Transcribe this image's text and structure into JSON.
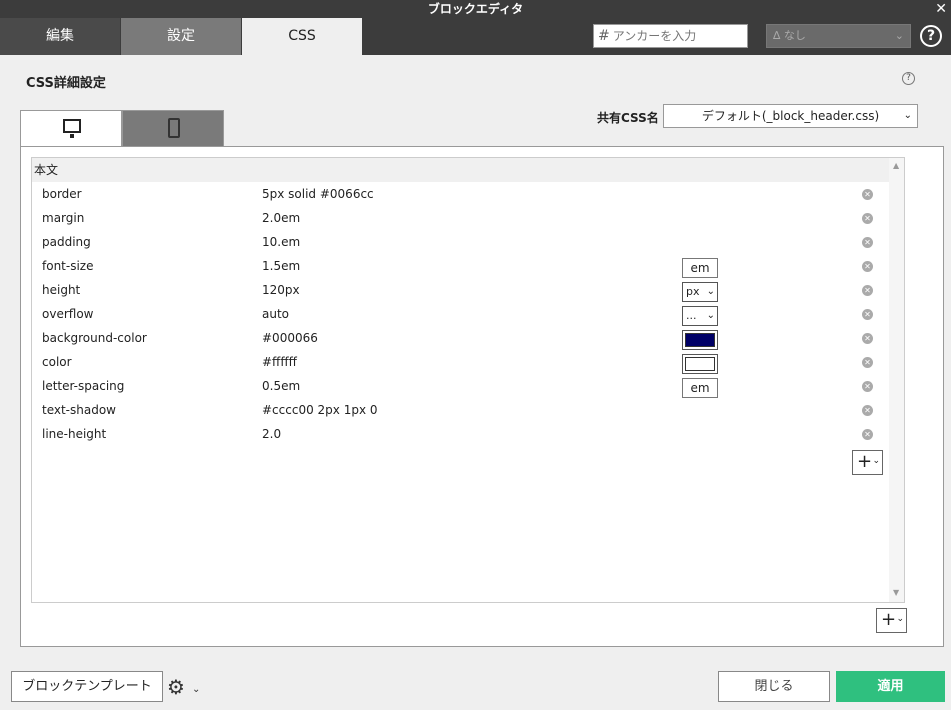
{
  "window": {
    "title": "ブロックエディタ",
    "close_glyph": "✕"
  },
  "tabs": [
    {
      "label": "編集"
    },
    {
      "label": "設定"
    },
    {
      "label": "CSS"
    }
  ],
  "anchor": {
    "placeholder": "アンカーを入力",
    "icon": "#"
  },
  "style_select": {
    "value": "なし",
    "icon": "∆"
  },
  "help_glyph": "?",
  "section": {
    "title": "CSS詳細設定"
  },
  "shared_css": {
    "label": "共有CSS名",
    "value": "デフォルト(_block_header.css)"
  },
  "group": {
    "label": "本文"
  },
  "rows": [
    {
      "prop": "border",
      "value": "5px solid #0066cc"
    },
    {
      "prop": "margin",
      "value": "2.0em"
    },
    {
      "prop": "padding",
      "value": "10.em"
    },
    {
      "prop": "font-size",
      "value": "1.5em",
      "unit": "em"
    },
    {
      "prop": "height",
      "value": "120px",
      "unit_select": "px"
    },
    {
      "prop": "overflow",
      "value": "auto",
      "unit_select": "..."
    },
    {
      "prop": "background-color",
      "value": "#000066",
      "swatch": "#000066"
    },
    {
      "prop": "color",
      "value": "#ffffff",
      "swatch": "#ffffff"
    },
    {
      "prop": "letter-spacing",
      "value": "0.5em",
      "unit": "em"
    },
    {
      "prop": "text-shadow",
      "value": "#cccc00 2px 1px 0"
    },
    {
      "prop": "line-height",
      "value": "2.0"
    }
  ],
  "footer": {
    "template_label": "ブロックテンプレート",
    "close_label": "閉じる",
    "apply_label": "適用"
  },
  "colors": {
    "apply": "#2fc07f",
    "tab_dark": "#3c3c3c"
  }
}
